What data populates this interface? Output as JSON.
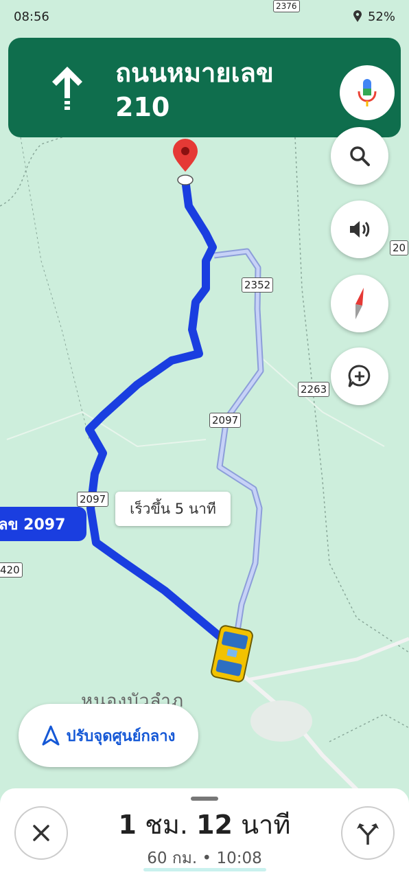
{
  "status": {
    "time": "08:56",
    "battery": "52%",
    "icon": "location-pin-icon"
  },
  "banner": {
    "street_line1": "ถนนหมายเลข",
    "street_line2": "210",
    "icon": "arrow-up-icon"
  },
  "map_controls": [
    {
      "name": "search-button",
      "icon": "search-icon"
    },
    {
      "name": "sound-button",
      "icon": "volume-icon"
    },
    {
      "name": "compass-button",
      "icon": "compass-icon"
    },
    {
      "name": "add-report-button",
      "icon": "add-comment-icon"
    }
  ],
  "road_labels": {
    "r2376": "2376",
    "r2352": "2352",
    "r2097a": "2097",
    "r2097b": "2097",
    "r2263": "2263",
    "r420": "420",
    "r20": "20"
  },
  "current_road_badge": "ลข 2097",
  "alt_route_label": "เร็วขึ้น 5 นาที",
  "town_label": "หนองบัวลำภู",
  "recenter": {
    "label": "ปรับจุดศูนย์กลาง",
    "icon": "navigation-arrow-icon"
  },
  "trip": {
    "hours": "1",
    "hours_unit": "ชม.",
    "minutes": "12",
    "minutes_unit": "นาที",
    "distance": "60 กม.",
    "separator": "•",
    "arrival": "10:08"
  },
  "colors": {
    "banner": "#0f6e4d",
    "route": "#1a3ee0",
    "alt_route": "#a9b8f2",
    "map": "#cdeedc"
  }
}
